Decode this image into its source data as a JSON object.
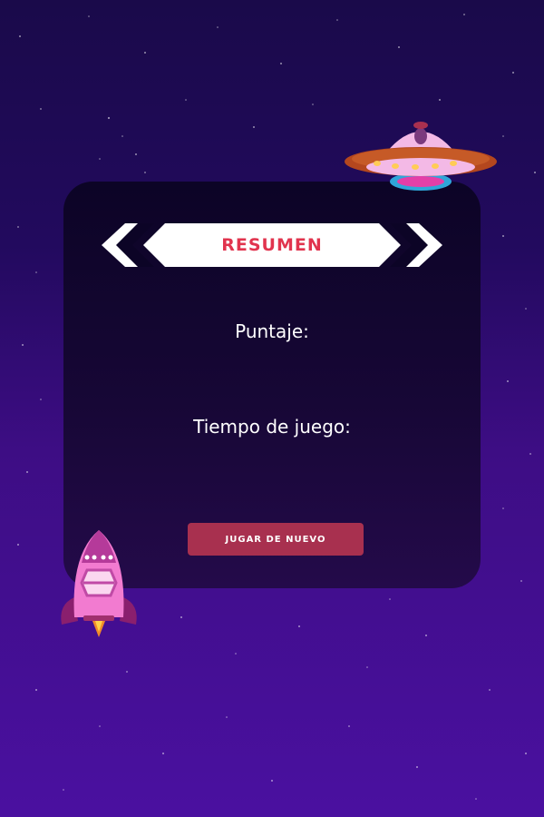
{
  "summary": {
    "title": "RESUMEN",
    "score_label": "Puntaje:",
    "time_label": "Tiempo de juego:",
    "play_again_label": "JUGAR DE NUEVO"
  },
  "icons": {
    "ufo": "ufo-icon",
    "rocket": "rocket-icon",
    "banner": "chevron-banner"
  },
  "colors": {
    "background_top": "#1a0a4a",
    "background_bottom": "#4a10a0",
    "card": "#0c0426",
    "title": "#e1344e",
    "button": "#a8304f"
  }
}
